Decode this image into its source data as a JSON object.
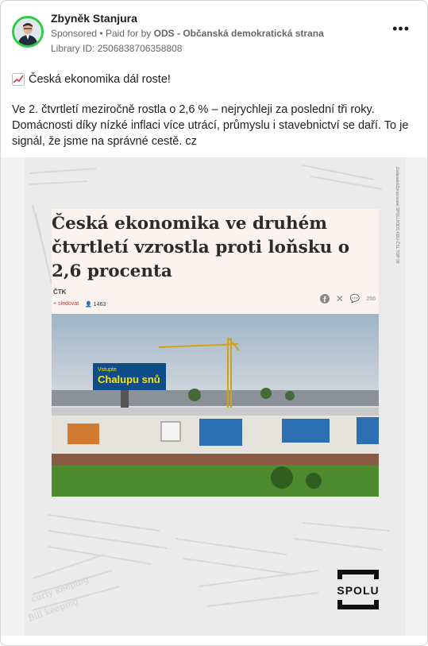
{
  "post": {
    "author": "Zbyněk Stanjura",
    "sponsored": "Sponsored",
    "paid_for_prefix": "Paid for by",
    "paid_for_by": "ODS - Občanská demokratická strana",
    "library_id": "Library ID: 2506838706358808",
    "headline": "Česká ekonomika dál roste!",
    "body": "Ve 2. čtvrtletí meziročně rostla o 2,6 % – nejrychleji za poslední tři roky. Domácnosti díky nízké inflaci více utrácí, průmyslu i stavebnictví se daří. To je signál, že jsme na správné cestě. cz"
  },
  "media": {
    "article_title": "Česká ekonomika ve druhém čtvrtletí vzrostla proti loňsku o 2,6 procenta",
    "source": "ČTK",
    "follow": "+ sledovat",
    "followers": "1463",
    "comments": "266",
    "billboard_line1": "Vstupte",
    "billboard_line2": "Chalupu snů",
    "logo": "SPOLU",
    "side_credit": "Zadavatel/Zpracovatel SPOLU/ODS KDU-ČSL TOP 09"
  },
  "colors": {
    "avatar_ring": "#2ecc40",
    "meta_gray": "#65676b"
  },
  "icons": {
    "more": "more-dots-icon",
    "chart": "chart-increasing-icon"
  }
}
